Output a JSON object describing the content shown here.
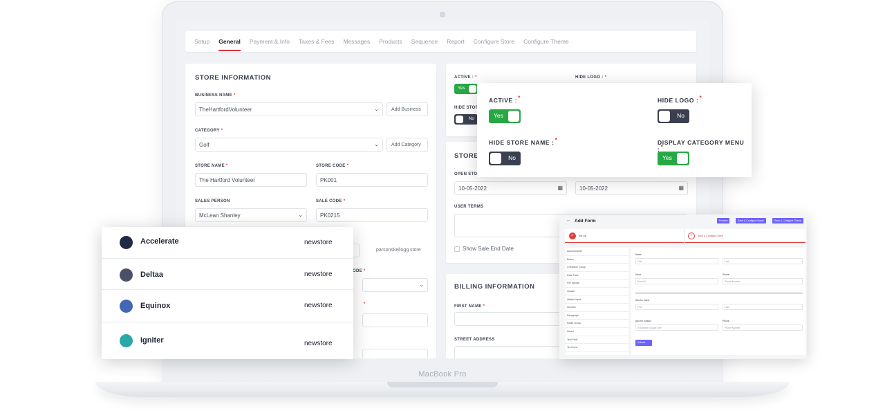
{
  "laptop": {
    "brand": "MacBook Pro"
  },
  "tabs": [
    "Setup",
    "General",
    "Payment & Info",
    "Taxes & Fees",
    "Messages",
    "Products",
    "Sequence",
    "Report",
    "Configure Store",
    "Configure Theme"
  ],
  "active_tab": "General",
  "store_info": {
    "title": "STORE INFORMATION",
    "business_name_label": "BUSINESS NAME",
    "business_name_value": "TheHartfordVolunteer",
    "add_business": "Add Business",
    "category_label": "CATEGORY",
    "category_value": "Golf",
    "add_category": "Add Category",
    "store_name_label": "STORE NAME",
    "store_name_value": "The Hartford Volunteer",
    "store_code_label": "STORE CODE",
    "store_code_value": "PK001",
    "sales_person_label": "SALES PERSON",
    "sales_person_value": "McLean Shanley",
    "sale_code_label": "SALE CODE",
    "sale_code_value": "PK0215",
    "domain_suffix": "parsonskellogg.store",
    "partial_label": "ODE"
  },
  "status_card": {
    "active_label": "ACTIVE :",
    "active_value": "Yes",
    "hide_logo_label": "HIDE LOGO :",
    "hide_store_label": "HIDE STOR",
    "hide_store_value": "No"
  },
  "store_dates": {
    "title_partial": "STORE",
    "open_label_partial": "OPEN STOR",
    "open_date": "10-05-2022",
    "end_date": "10-05-2022",
    "user_terms_label": "USER TERMS",
    "show_sale_end": "Show Sale End Date"
  },
  "billing": {
    "title": "BILLING INFORMATION",
    "first_name_label": "FIRST NAME",
    "street_label": "STREET ADDRESS"
  },
  "popup": {
    "active_label": "ACTIVE :",
    "active_value": "Yes",
    "hide_logo_label": "HIDE LOGO :",
    "hide_logo_value": "No",
    "hide_store_name_label": "HIDE STORE NAME :",
    "hide_store_name_value": "No",
    "display_category_label": "DISPLAY CATEGORY MENU :",
    "display_category_value": "Yes"
  },
  "stores": [
    {
      "name": "Accelerate",
      "type": "newstore",
      "color": "#1f2a44"
    },
    {
      "name": "Deltaa",
      "type": "newstore",
      "color": "#4a5068"
    },
    {
      "name": "Equinox",
      "type": "newstore",
      "color": "#4466b3"
    },
    {
      "name": "Igniter",
      "type": "newstore",
      "color": "#2aa7a7"
    }
  ],
  "add_form": {
    "title": "Add Form",
    "buttons": [
      "Preview",
      "Save & Configure Board",
      "Save & Configure Theme"
    ],
    "step1": "Set Up",
    "step2": "Save & Configure Store",
    "side_items": [
      "Autocomplete",
      "Button",
      "Checkbox Group",
      "Date Field",
      "File Upload",
      "Header",
      "Hidden Input",
      "Number",
      "Paragraph",
      "Radio Group",
      "Select",
      "Text Field",
      "Text Area"
    ],
    "name_label": "Name",
    "first_ph": "First",
    "last_ph": "Last",
    "email_label": "Inbox",
    "email_ph": "Email id",
    "phone_label": "Phone",
    "phone_ph": "Phone Number",
    "second_name_label": "Add for name",
    "contact_label": "Add for contact",
    "contact_ph": "In Surface Google Line",
    "submit": "Submit"
  },
  "colors": {
    "accent": "#e0323c",
    "toggle_yes": "#27a844",
    "toggle_no": "#3a4050",
    "form_button": "#6c63ff"
  }
}
